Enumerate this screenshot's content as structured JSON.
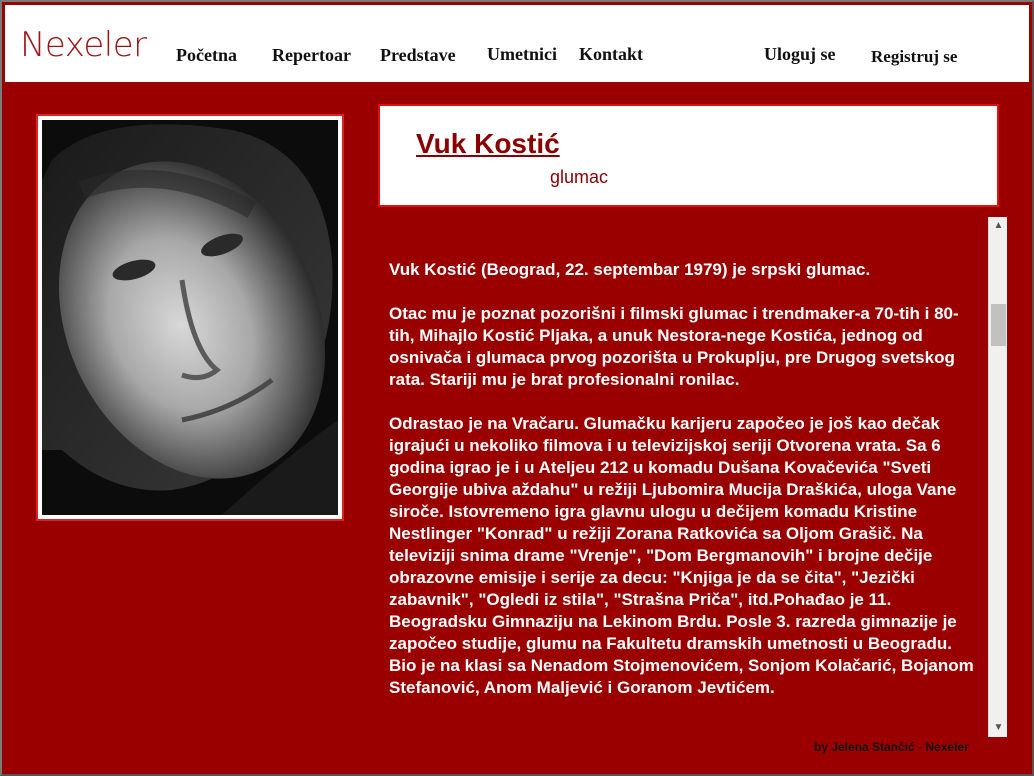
{
  "header": {
    "logo": "Nexeler",
    "nav": [
      "Početna",
      "Repertoar",
      "Predstave",
      "Umetnici",
      "Kontakt"
    ],
    "login": "Uloguj se",
    "register": "Registruj se"
  },
  "artist": {
    "name": "Vuk Kostić",
    "role": "glumac",
    "bio": [
      "Vuk Kostić (Beograd, 22. septembar 1979) je srpski glumac.",
      "Otac mu je poznat pozorišni i filmski glumac i trendmaker-a 70-tih i 80-tih, Mihajlo Kostić Pljaka, a unuk Nestora-nege Kostića, jednog od osnivača i glumaca prvog pozorišta u Prokuplju, pre Drugog svetskog rata. Stariji mu je brat profesionalni ronilac.",
      "Odrastao je na Vračaru. Glumačku karijeru započeo je još kao dečak igrajući u nekoliko filmova i u televizijskoj seriji Otvorena vrata. Sa 6 godina igrao je i u Ateljeu 212 u komadu Dušana Kovačevića \"Sveti Georgije ubiva aždahu\" u režiji Ljubomira Mucija Draškića, uloga Vane siroče. Istovremeno igra glavnu ulogu u dečijem komadu Kristine Nestlinger \"Konrad\" u režiji Zorana Ratkovića sa Oljom Grašič. Na televiziji snima drame \"Vrenje\", \"Dom Bergmanovih\" i brojne dečije obrazovne emisije i serije za decu: \"Knjiga je da se čita\", \"Jezički zabavnik\", \"Ogledi iz stila\", \"Strašna Priča\", itd.Pohađao je 11. Beogradsku Gimnaziju na Lekinom Brdu. Posle 3. razreda gimnazije je započeo studije, glumu na Fakultetu dramskih umetnosti u Beogradu. Bio je na klasi sa Nenadom Stojmenovićem, Sonjom Kolačarić, Bojanom Stefanović, Anom Maljević i Goranom Jevtićem."
    ]
  },
  "footer": "by Jelena Stančić - Nexeler",
  "icons": {
    "scroll_up": "chevron-up-icon",
    "scroll_down": "chevron-down-icon"
  },
  "colors": {
    "background": "#9b0000",
    "accent": "#8a0000",
    "border": "#e01010"
  }
}
